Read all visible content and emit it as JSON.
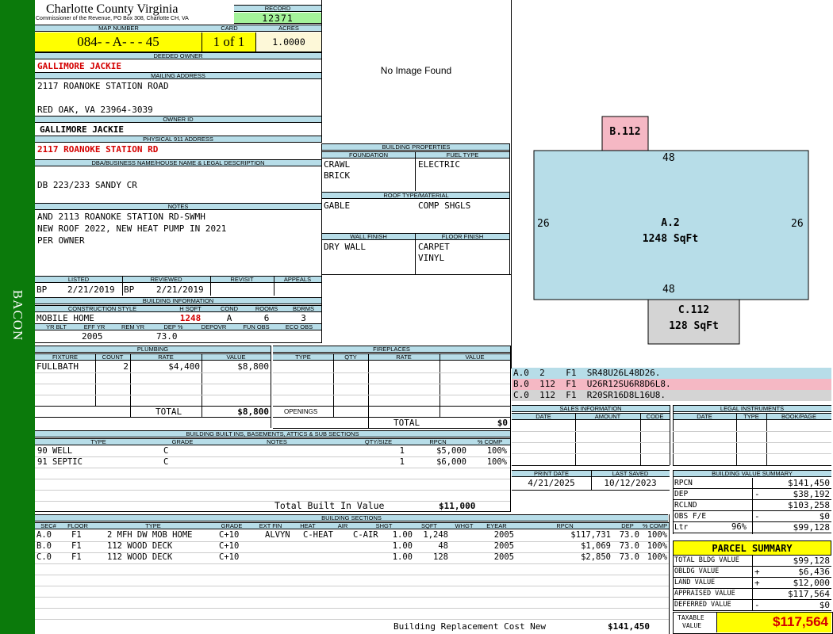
{
  "side_label": "BACON",
  "county": {
    "name": "Charlotte County Virginia",
    "address": "Commissioner of the Revenue, PO Box 308, Charlotte CH, VA"
  },
  "record": {
    "label": "RECORD",
    "value": "12371"
  },
  "map": {
    "label": "MAP NUMBER",
    "value": "084- - A- - - 45",
    "card_label": "CARD",
    "card": "1 of 1",
    "acres_label": "ACRES",
    "acres": "1.0000"
  },
  "owner": {
    "deeded_label": "DEEDED OWNER",
    "deeded": "GALLIMORE JACKIE",
    "mailing_label": "MAILING ADDRESS",
    "mail1": "2117 ROANOKE STATION ROAD",
    "mail2": "RED OAK, VA 23964-3039",
    "id_label": "OWNER ID",
    "owner_id": "GALLIMORE JACKIE",
    "phys_label": "PHYSICAL 911 ADDRESS",
    "physical": "2117 ROANOKE STATION RD"
  },
  "legal": {
    "label": "DBA/BUSINESS NAME/HOUSE NAME & LEGAL DESCRIPTION",
    "value": "DB 223/233 SANDY CR"
  },
  "notes": {
    "label": "NOTES",
    "line1": "AND 2113 ROANOKE STATION RD-SWMH",
    "line2": "NEW ROOF 2022, NEW HEAT PUMP IN 2021",
    "line3": "PER OWNER"
  },
  "image_text": "No Image Found",
  "building_props": {
    "label": "BUILDING PROPERTIES",
    "foundation_label": "FOUNDATION",
    "foundation1": "CRAWL",
    "foundation2": "BRICK",
    "fuel_label": "FUEL TYPE",
    "fuel": "ELECTRIC",
    "roof_label": "ROOF TYPE/MATERIAL",
    "roof_type": "GABLE",
    "roof_mat": "COMP SHGLS",
    "wall_label": "WALL FINISH",
    "wall": "DRY WALL",
    "floor_label": "FLOOR FINISH",
    "floor1": "CARPET",
    "floor2": "VINYL"
  },
  "listed": {
    "listed_label": "LISTED",
    "listed_by": "BP",
    "listed_date": "2/21/2019",
    "reviewed_label": "REVIEWED",
    "reviewed_by": "BP",
    "reviewed_date": "2/21/2019",
    "revisit_label": "REVISIT",
    "appeals_label": "APPEALS"
  },
  "building_info": {
    "label": "BUILDING INFORMATION",
    "cs_label": "CONSTRUCTION STYLE",
    "cs": "MOBILE HOME",
    "hsqft_label": "H SQFT",
    "hsqft": "1248",
    "cond_label": "COND",
    "cond": "A",
    "rooms_label": "ROOMS",
    "rooms": "6",
    "bdrms_label": "BDRMS",
    "bdrms": "3",
    "yrblt_label": "YR BLT",
    "effyr_label": "EFF YR",
    "effyr": "2005",
    "remyr_label": "REM YR",
    "dep_label": "DEP %",
    "dep": "73.0",
    "depovr_label": "DEPOVR",
    "funobs_label": "FUN OBS",
    "ecoobs_label": "ECO OBS"
  },
  "plumbing": {
    "label": "PLUMBING",
    "fixture_label": "FIXTURE",
    "count_label": "COUNT",
    "rate_label": "RATE",
    "value_label": "VALUE",
    "fixture": "FULLBATH",
    "count": "2",
    "rate": "$4,400",
    "value": "$8,800",
    "total_label": "TOTAL",
    "total": "$8,800"
  },
  "fireplaces": {
    "label": "FIREPLACES",
    "type_label": "TYPE",
    "qty_label": "QTY",
    "rate_label": "RATE",
    "value_label": "VALUE",
    "openings_label": "OPENINGS",
    "total_label": "TOTAL",
    "total": "$0"
  },
  "builtins": {
    "label": "BUILDING BUILT INS, BASEMENTS, ATTICS & SUB SECTIONS",
    "type_label": "TYPE",
    "grade_label": "GRADE",
    "notes_label": "NOTES",
    "qty_label": "QTY/SIZE",
    "rpcn_label": "RPCN",
    "comp_label": "% COMP",
    "rows": [
      {
        "type": "90 WELL",
        "grade": "C",
        "qty": "1",
        "rpcn": "$5,000",
        "comp": "100%"
      },
      {
        "type": "91 SEPTIC",
        "grade": "C",
        "qty": "1",
        "rpcn": "$6,000",
        "comp": "100%"
      }
    ],
    "total_label": "Total Built In Value",
    "total": "$11,000"
  },
  "sections": {
    "label": "BUILDING SECTIONS",
    "headers": [
      "SEC#",
      "FLOOR",
      "TYPE",
      "GRADE",
      "EXT FIN",
      "HEAT",
      "AIR",
      "SHGT",
      "SQFT",
      "WHGT",
      "EYEAR",
      "RPCN",
      "DEP",
      "% COMP"
    ],
    "rows": [
      {
        "sec": "A.0",
        "floor": "F1",
        "type": "2 MFH DW MOB HOME",
        "grade": "C+10",
        "ext": "ALVYN",
        "heat": "C-HEAT",
        "air": "C-AIR",
        "shgt": "1.00",
        "sqft": "1,248",
        "eyear": "2005",
        "rpcn": "$117,731",
        "dep": "73.0",
        "comp": "100%"
      },
      {
        "sec": "B.0",
        "floor": "F1",
        "type": "112 WOOD DECK",
        "grade": "C+10",
        "ext": "",
        "heat": "",
        "air": "",
        "shgt": "1.00",
        "sqft": "48",
        "eyear": "2005",
        "rpcn": "$1,069",
        "dep": "73.0",
        "comp": "100%"
      },
      {
        "sec": "C.0",
        "floor": "F1",
        "type": "112 WOOD DECK",
        "grade": "C+10",
        "ext": "",
        "heat": "",
        "air": "",
        "shgt": "1.00",
        "sqft": "128",
        "eyear": "2005",
        "rpcn": "$2,850",
        "dep": "73.0",
        "comp": "100%"
      }
    ],
    "rcn_label": "Building Replacement Cost New",
    "rcn": "$141,450"
  },
  "sketch": {
    "b_label": "B.112",
    "a_label": "A.2",
    "a_area": "1248 SqFt",
    "c_label": "C.112",
    "c_area": "128 SqFt",
    "top": "48",
    "bottom": "48",
    "left": "26",
    "right": "26",
    "legend": [
      {
        "text": "A.0  2    F1  SR48U26L48D26.",
        "color": "#b7dde8"
      },
      {
        "text": "B.0  112  F1  U26R12SU6R8D6L8.",
        "color": "#f5b8c4"
      },
      {
        "text": "C.0  112  F1  R20SR16D8L16U8.",
        "color": "#d4d4d4"
      }
    ]
  },
  "sales": {
    "label": "SALES INFORMATION",
    "date_label": "DATE",
    "amount_label": "AMOUNT",
    "code_label": "CODE"
  },
  "legal_instr": {
    "label": "LEGAL INSTRUMENTS",
    "date_label": "DATE",
    "type_label": "TYPE",
    "book_label": "BOOK/PAGE"
  },
  "print": {
    "print_label": "PRINT DATE",
    "print_date": "4/21/2025",
    "saved_label": "LAST SAVED",
    "saved_date": "10/12/2023"
  },
  "value_summary": {
    "label": "BUILDING VALUE SUMMARY",
    "rows": [
      {
        "label": "RPCN",
        "sign": "",
        "pct": "",
        "value": "$141,450"
      },
      {
        "label": "DEP",
        "sign": "-",
        "pct": "",
        "value": "$38,192"
      },
      {
        "label": "RCLND",
        "sign": "",
        "pct": "",
        "value": "$103,258"
      },
      {
        "label": "OBS F/E",
        "sign": "-",
        "pct": "",
        "value": "$0"
      },
      {
        "label": "Ltr",
        "sign": "",
        "pct": "96%",
        "value": "$99,128"
      }
    ]
  },
  "parcel": {
    "label": "PARCEL SUMMARY",
    "rows": [
      {
        "label": "TOTAL BLDG VALUE",
        "sign": "",
        "value": "$99,128"
      },
      {
        "label": "OBLDG VALUE",
        "sign": "+",
        "value": "$6,436"
      },
      {
        "label": "LAND VALUE",
        "sign": "+",
        "value": "$12,000"
      },
      {
        "label": "APPRAISED VALUE",
        "sign": "",
        "value": "$117,564"
      },
      {
        "label": "DEFERRED VALUE",
        "sign": "-",
        "value": "$0"
      }
    ],
    "taxable_label1": "TAXABLE",
    "taxable_label2": "VALUE",
    "taxable": "$117,564"
  },
  "colors": {
    "green": "#0b7a0b",
    "header": "#b7dde8",
    "yellow": "#ffff00",
    "record_green": "#a4f39a",
    "red": "#d40000"
  }
}
